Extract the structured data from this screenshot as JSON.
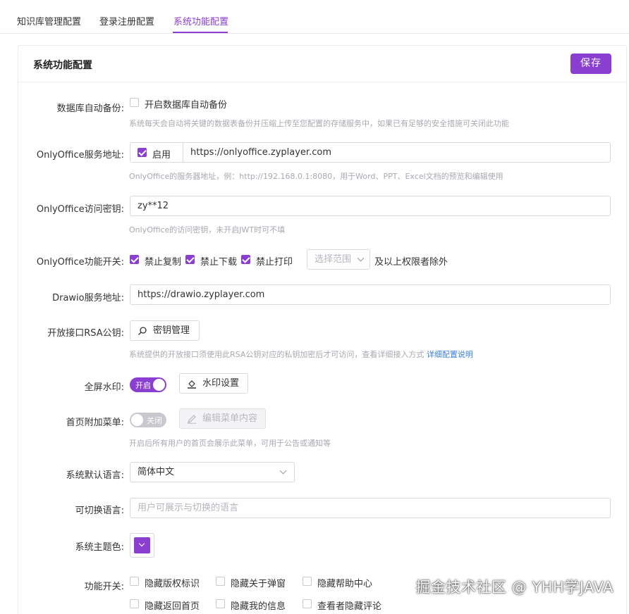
{
  "tabs": [
    {
      "label": "知识库管理配置",
      "active": false
    },
    {
      "label": "登录注册配置",
      "active": false
    },
    {
      "label": "系统功能配置",
      "active": true
    }
  ],
  "card": {
    "title": "系统功能配置",
    "save_label": "保存"
  },
  "db_backup": {
    "label": "数据库自动备份:",
    "checkbox_label": "开启数据库自动备份",
    "checked": false,
    "help": "系统每天会自动将关键的数据表备份并压缩上传至您配置的存储服务中，如果已有足够的安全措施可关闭此功能"
  },
  "onlyoffice_url": {
    "label": "OnlyOffice服务地址:",
    "enable_label": "启用",
    "enabled": true,
    "value": "https://onlyoffice.zyplayer.com",
    "help": "OnlyOffice的服务器地址，例：http://192.168.0.1:8080，用于Word、PPT、Excel文档的预览和编辑使用"
  },
  "onlyoffice_secret": {
    "label": "OnlyOffice访问密钥:",
    "value": "zy**12",
    "help": "OnlyOffice的访问密钥，未开启JWT时可不填"
  },
  "onlyoffice_switches": {
    "label": "OnlyOffice功能开关:",
    "items": [
      {
        "label": "禁止复制",
        "checked": true
      },
      {
        "label": "禁止下载",
        "checked": true
      },
      {
        "label": "禁止打印",
        "checked": true
      }
    ],
    "scope_placeholder": "选择范围",
    "suffix": "及以上权限者除外"
  },
  "drawio": {
    "label": "Drawio服务地址:",
    "value": "https://drawio.zyplayer.com"
  },
  "rsa": {
    "label": "开放接口RSA公钥:",
    "button_label": "密钥管理",
    "help": "系统提供的开放接口须使用此RSA公钥对应的私钥加密后才可访问，查看详细接入方式",
    "help_link": "详细配置说明"
  },
  "fullscreen_watermark": {
    "label": "全屏水印:",
    "switch_text": "开启",
    "on": true,
    "button_label": "水印设置"
  },
  "home_menu": {
    "label": "首页附加菜单:",
    "switch_text": "关闭",
    "on": false,
    "button_label": "编辑菜单内容",
    "help": "开启后所有用户的首页会展示此菜单，可用于公告或通知等"
  },
  "default_language": {
    "label": "系统默认语言:",
    "value": "简体中文"
  },
  "switchable_language": {
    "label": "可切换语言:",
    "placeholder": "用户可展示与切换的语言"
  },
  "theme_color": {
    "label": "系统主题色:",
    "color": "#8a3fd1"
  },
  "feature_switches": {
    "label": "功能开关:",
    "items": [
      {
        "label": "隐藏版权标识",
        "checked": false
      },
      {
        "label": "隐藏关于弹窗",
        "checked": false
      },
      {
        "label": "隐藏帮助中心",
        "checked": false
      },
      {
        "label": "隐藏返回首页",
        "checked": false
      },
      {
        "label": "隐藏我的信息",
        "checked": false
      },
      {
        "label": "查看者隐藏评论",
        "checked": false
      }
    ]
  },
  "overlay_watermark": "掘金技术社区 @ YHH学JAVA",
  "colors": {
    "accent": "#8a3fd1",
    "link": "#3a7ee0",
    "help_text": "#a8a8b0"
  }
}
